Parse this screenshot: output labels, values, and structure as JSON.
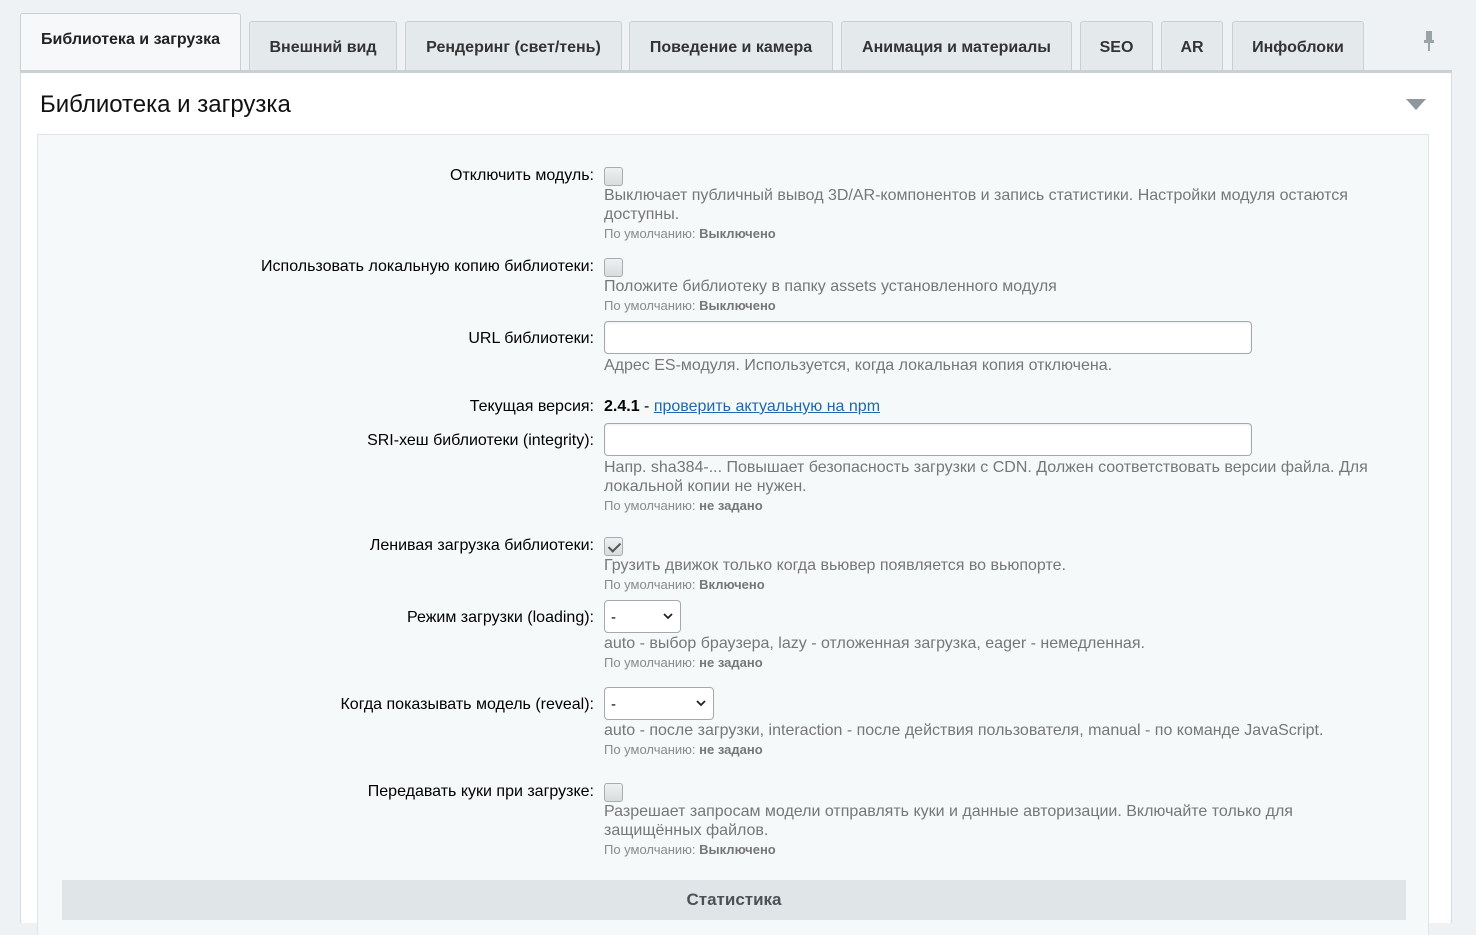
{
  "tabs": [
    {
      "label": "Библиотека и загрузка"
    },
    {
      "label": "Внешний вид"
    },
    {
      "label": "Рендеринг (свет/тень)"
    },
    {
      "label": "Поведение и камера"
    },
    {
      "label": "Анимация и материалы"
    },
    {
      "label": "SEO"
    },
    {
      "label": "AR"
    },
    {
      "label": "Инфоблоки"
    }
  ],
  "section": {
    "title": "Библиотека и загрузка",
    "default_prefix": "По умолчанию:",
    "stats_label": "Статистика"
  },
  "fields": {
    "disable_module": {
      "label": "Отключить модуль:",
      "checked": false,
      "desc": "Выключает публичный вывод 3D/AR-компонентов и запись статистики. Настройки модуля остаются доступны.",
      "default": "Выключено"
    },
    "local_copy": {
      "label": "Использовать локальную копию библиотеки:",
      "checked": false,
      "desc": "Положите библиотеку в папку assets установленного модуля",
      "default": "Выключено"
    },
    "library_url": {
      "label": "URL библиотеки:",
      "value": "",
      "desc": "Адрес ES-модуля. Используется, когда локальная копия отключена."
    },
    "current_version": {
      "label": "Текущая версия:",
      "value": "2.4.1",
      "separator": "-",
      "link": "проверить актуальную на npm"
    },
    "sri_hash": {
      "label": "SRI-хеш библиотеки (integrity):",
      "value": "",
      "desc": "Напр. sha384-... Повышает безопасность загрузки с CDN. Должен соответствовать версии файла. Для локальной копии не нужен.",
      "default": "не задано"
    },
    "lazy_load": {
      "label": "Ленивая загрузка библиотеки:",
      "checked": true,
      "desc": "Грузить движок только когда вьювер появляется во вьюпорте.",
      "default": "Включено"
    },
    "loading_mode": {
      "label": "Режим загрузки (loading):",
      "selected": "-",
      "desc": "auto - выбор браузера, lazy - отложенная загрузка, eager - немедленная.",
      "default": "не задано"
    },
    "reveal": {
      "label": "Когда показывать модель (reveal):",
      "selected": "-",
      "desc": "auto - после загрузки, interaction - после действия пользователя, manual - по команде JavaScript.",
      "default": "не задано"
    },
    "with_credentials": {
      "label": "Передавать куки при загрузке:",
      "checked": false,
      "desc": "Разрешает запросам модели отправлять куки и данные авторизации. Включайте только для защищённых файлов.",
      "default": "Выключено"
    }
  }
}
